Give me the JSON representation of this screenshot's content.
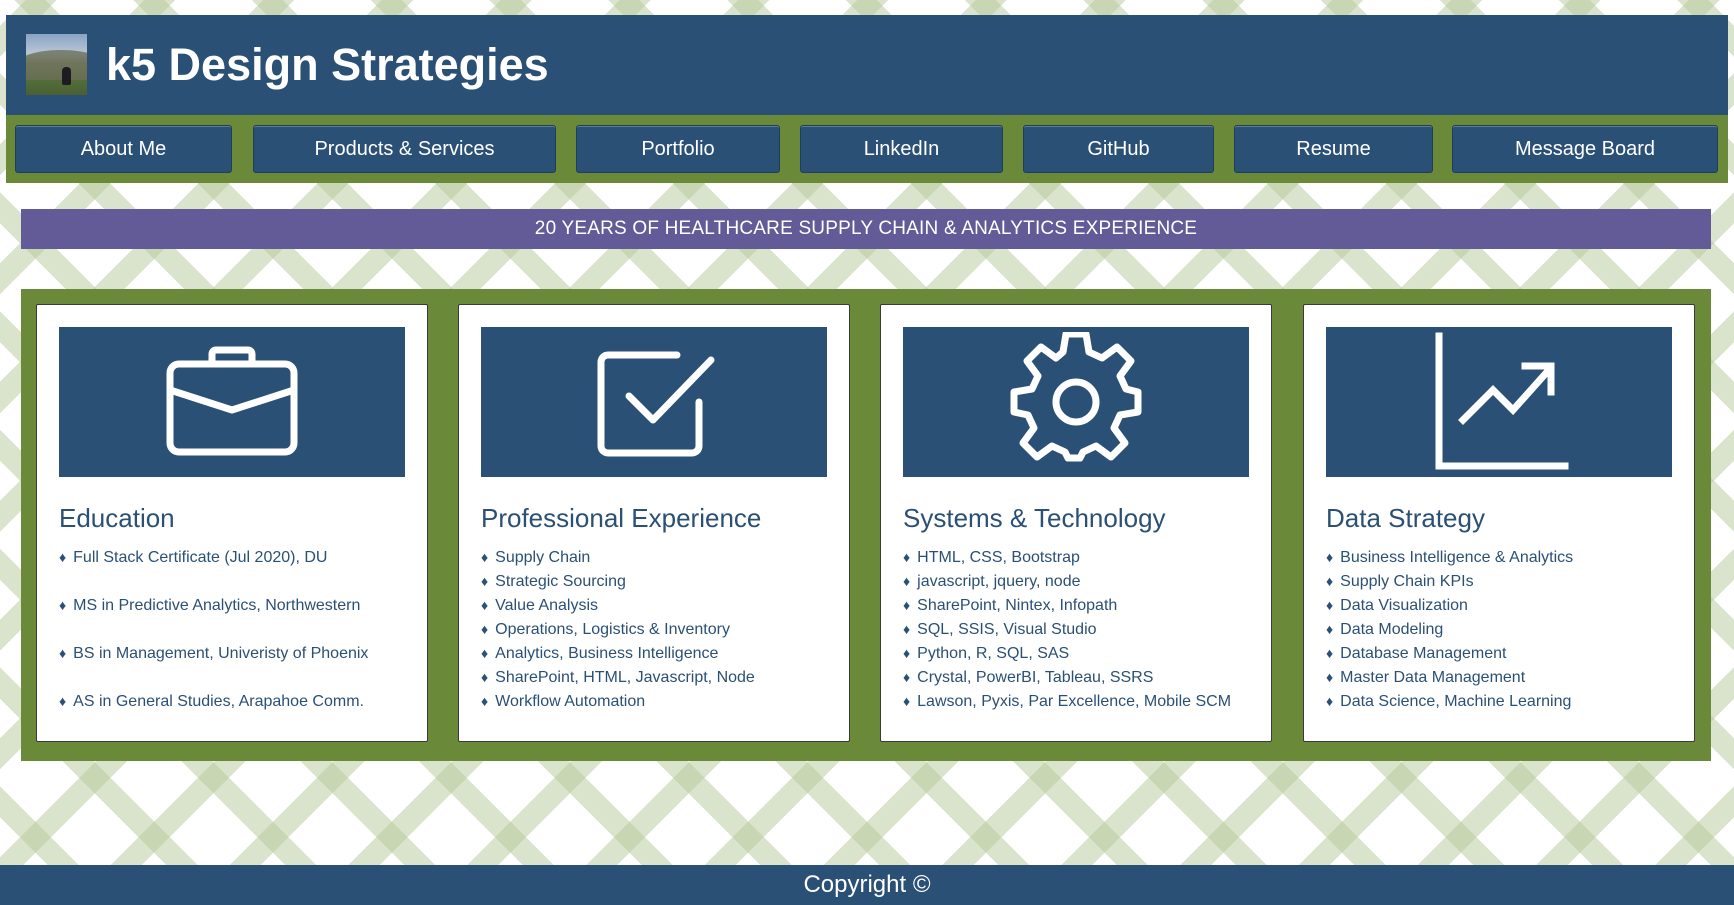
{
  "header": {
    "title": "k5 Design Strategies",
    "logo_icon": "profile-photo"
  },
  "nav": {
    "items": [
      {
        "label": "About Me"
      },
      {
        "label": "Products & Services"
      },
      {
        "label": "Portfolio"
      },
      {
        "label": "LinkedIn"
      },
      {
        "label": "GitHub"
      },
      {
        "label": "Resume"
      },
      {
        "label": "Message Board"
      }
    ]
  },
  "banner": {
    "text": "20 YEARS OF HEALTHCARE SUPPLY CHAIN & ANALYTICS EXPERIENCE"
  },
  "cards": [
    {
      "icon": "briefcase-icon",
      "title": "Education",
      "items": [
        "Full Stack Certificate (Jul 2020), DU",
        "MS in Predictive Analytics, Northwestern",
        "BS in Management, Univeristy of Phoenix",
        "AS in General Studies, Arapahoe Comm."
      ]
    },
    {
      "icon": "checkbox-icon",
      "title": "Professional Experience",
      "items": [
        "Supply Chain",
        "Strategic Sourcing",
        "Value Analysis",
        "Operations, Logistics & Inventory",
        "Analytics, Business Intelligence",
        "SharePoint, HTML, Javascript, Node",
        "Workflow Automation"
      ]
    },
    {
      "icon": "gear-icon",
      "title": "Systems & Technology",
      "items": [
        "HTML, CSS, Bootstrap",
        "javascript, jquery, node",
        "SharePoint, Nintex, Infopath",
        "SQL, SSIS, Visual Studio",
        "Python, R, SQL, SAS",
        "Crystal, PowerBI, Tableau, SSRS",
        "Lawson, Pyxis, Par Excellence, Mobile SCM"
      ]
    },
    {
      "icon": "line-chart-icon",
      "title": "Data Strategy",
      "items": [
        "Business Intelligence & Analytics",
        "Supply Chain KPIs",
        "Data Visualization",
        "Data Modeling",
        "Database Management",
        "Master Data Management",
        "Data Science, Machine Learning"
      ]
    }
  ],
  "footer": {
    "text": "Copyright ©"
  },
  "colors": {
    "primary": "#2b5075",
    "green": "#6a8a3a",
    "purple": "#635a98"
  }
}
